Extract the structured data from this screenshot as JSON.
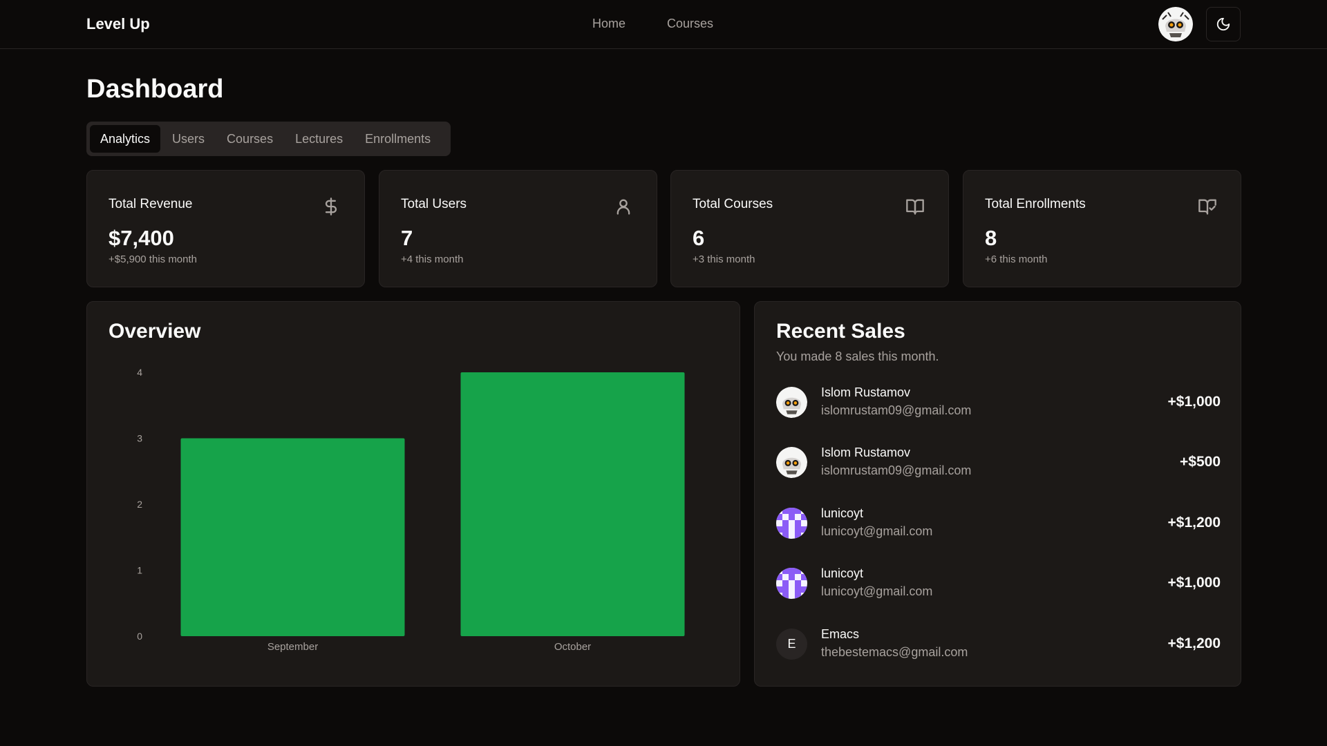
{
  "header": {
    "brand": "Level Up",
    "nav": [
      "Home",
      "Courses"
    ]
  },
  "page": {
    "title": "Dashboard",
    "tabs": [
      "Analytics",
      "Users",
      "Courses",
      "Lectures",
      "Enrollments"
    ],
    "active_tab": "Analytics"
  },
  "stats": [
    {
      "label": "Total Revenue",
      "value": "$7,400",
      "sub": "+$5,900 this month",
      "icon": "dollar-icon"
    },
    {
      "label": "Total Users",
      "value": "7",
      "sub": "+4 this month",
      "icon": "user-icon"
    },
    {
      "label": "Total Courses",
      "value": "6",
      "sub": "+3 this month",
      "icon": "book-open-icon"
    },
    {
      "label": "Total Enrollments",
      "value": "8",
      "sub": "+6 this month",
      "icon": "book-check-icon"
    }
  ],
  "overview": {
    "title": "Overview"
  },
  "chart_data": {
    "type": "bar",
    "categories": [
      "September",
      "October"
    ],
    "values": [
      3,
      4
    ],
    "ylim": [
      0,
      4
    ],
    "yticks": [
      "0",
      "1",
      "2",
      "3",
      "4"
    ],
    "color": "#16a34a",
    "grid": false
  },
  "sales": {
    "title": "Recent Sales",
    "description": "You made 8 sales this month.",
    "items": [
      {
        "name": "Islom Rustamov",
        "email": "islomrustam09@gmail.com",
        "amount": "+$1,000",
        "avatar": "skull-avatar"
      },
      {
        "name": "Islom Rustamov",
        "email": "islomrustam09@gmail.com",
        "amount": "+$500",
        "avatar": "skull-avatar"
      },
      {
        "name": "lunicoyt",
        "email": "lunicoyt@gmail.com",
        "amount": "+$1,200",
        "avatar": "identicon-avatar"
      },
      {
        "name": "lunicoyt",
        "email": "lunicoyt@gmail.com",
        "amount": "+$1,000",
        "avatar": "identicon-avatar"
      },
      {
        "name": "Emacs",
        "email": "thebestemacs@gmail.com",
        "amount": "+$1,200",
        "avatar": "E"
      }
    ]
  },
  "colors": {
    "background": "#0c0a09",
    "card": "#1c1917",
    "border": "#292524",
    "muted": "#a8a29e",
    "accent": "#16a34a"
  }
}
